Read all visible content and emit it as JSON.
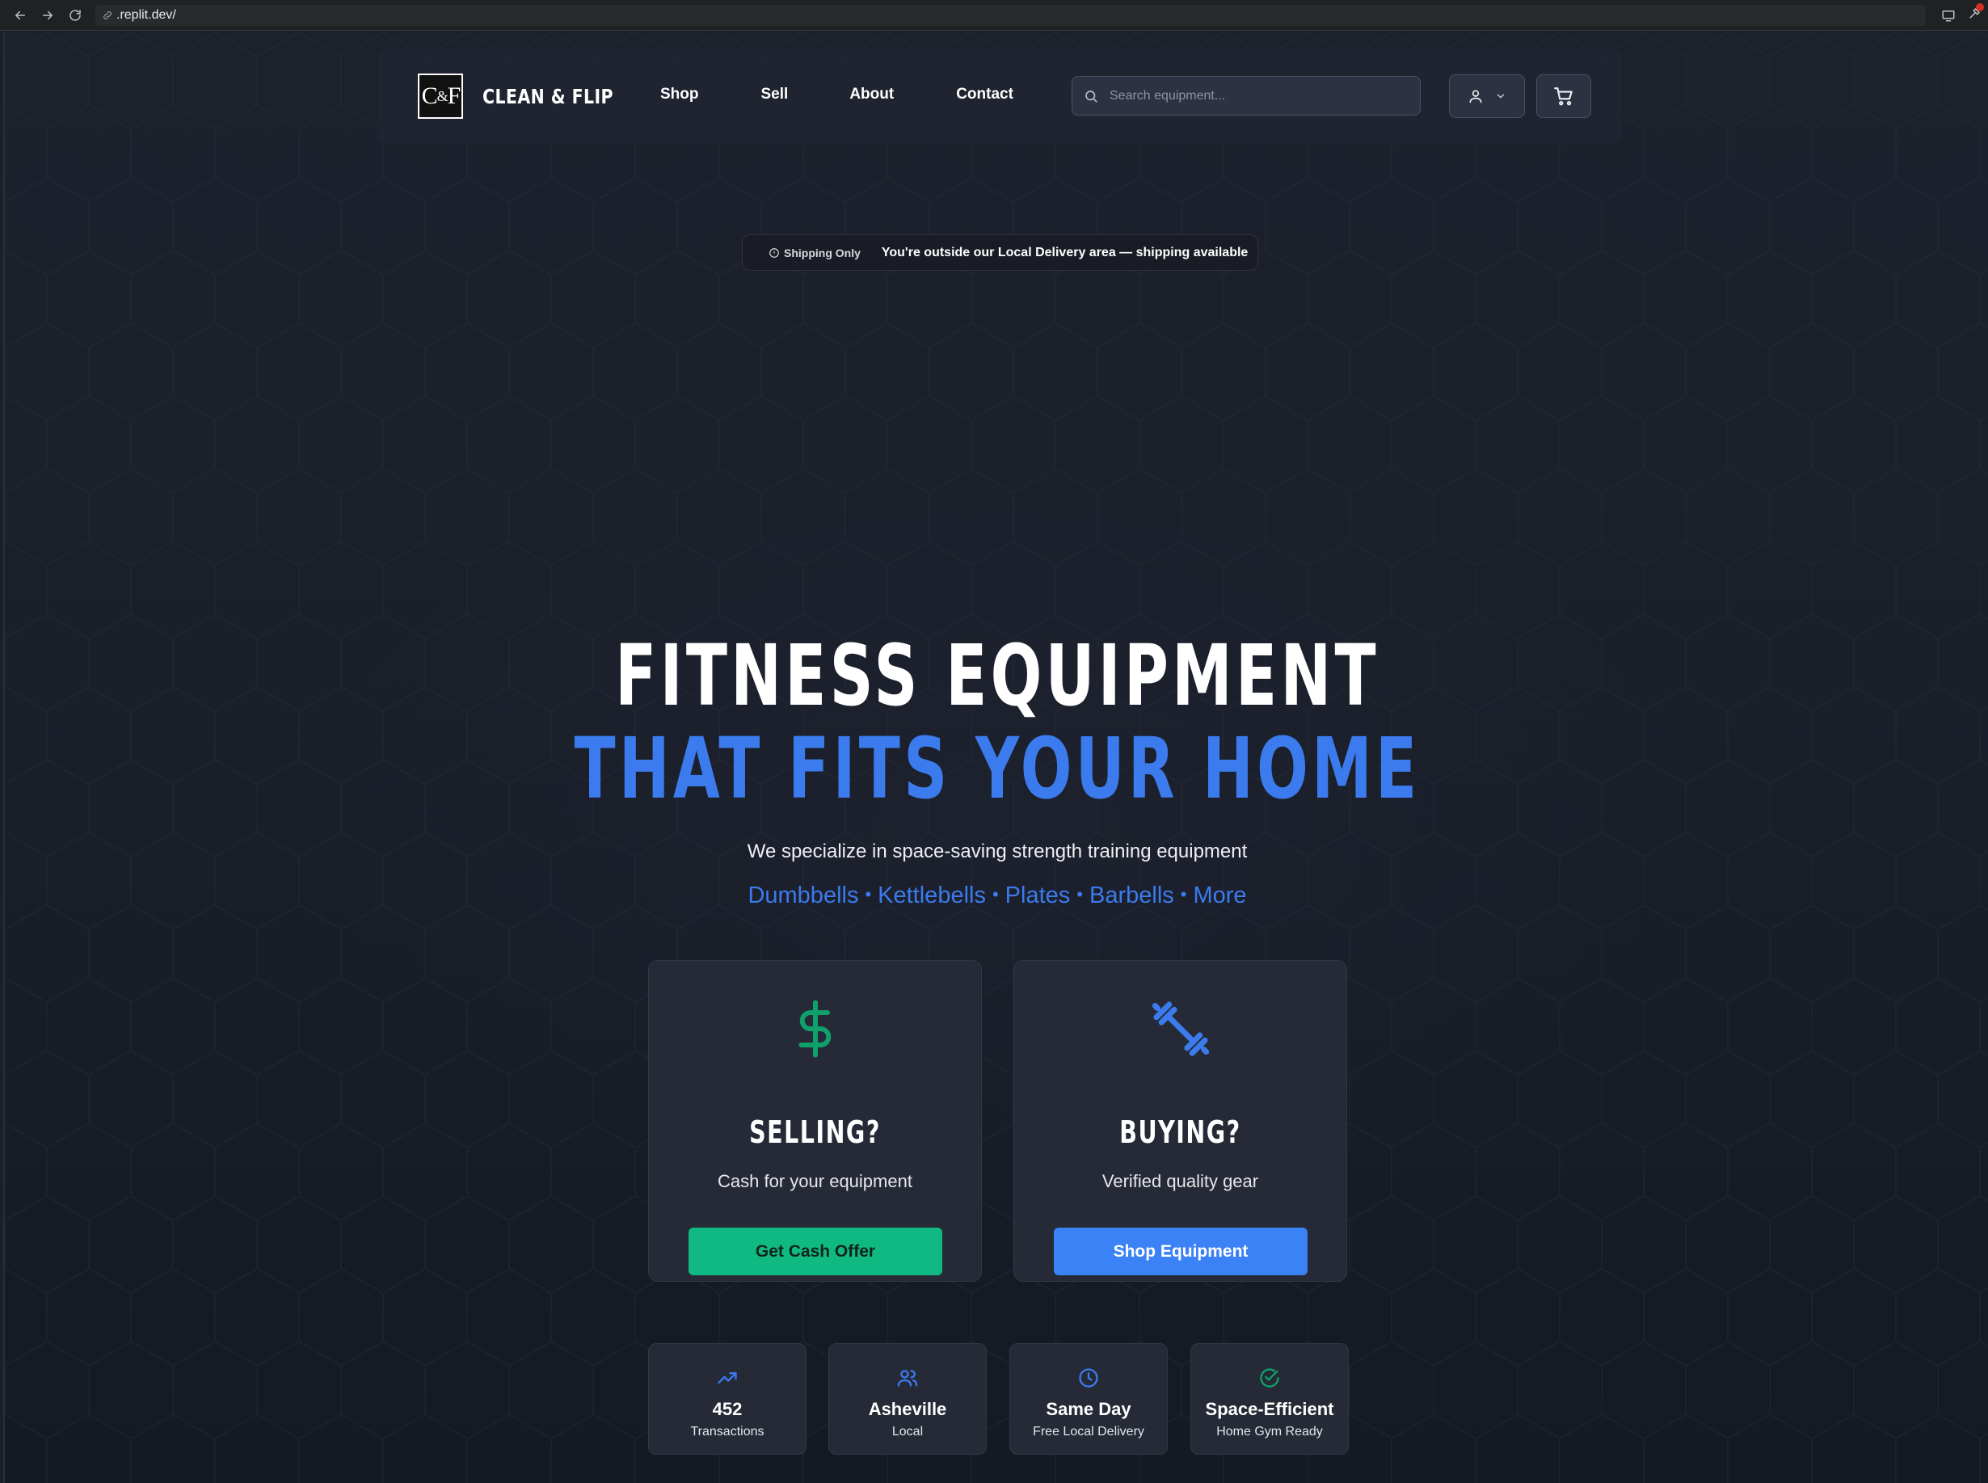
{
  "browser": {
    "url": ".replit.dev/"
  },
  "header": {
    "logo_mark_left": "C",
    "logo_mark_amp": "&",
    "logo_mark_right": "F",
    "brand": "CLEAN & FLIP",
    "nav": [
      "Shop",
      "Sell",
      "About",
      "Contact"
    ],
    "search_placeholder": "Search equipment..."
  },
  "shipping_banner": {
    "tag": "Shipping Only",
    "message": "You're outside our Local Delivery area — shipping available"
  },
  "hero": {
    "line1": "FITNESS EQUIPMENT",
    "line2": "THAT FITS YOUR HOME",
    "subtitle": "We specialize in space-saving strength training equipment",
    "categories": [
      "Dumbbells",
      "Kettlebells",
      "Plates",
      "Barbells",
      "More"
    ]
  },
  "cards": {
    "sell": {
      "icon": "dollar-icon",
      "title": "SELLING?",
      "subtitle": "Cash for your equipment",
      "button": "Get Cash Offer"
    },
    "buy": {
      "icon": "dumbbell-icon",
      "title": "BUYING?",
      "subtitle": "Verified quality gear",
      "button": "Shop Equipment"
    }
  },
  "stats": [
    {
      "icon": "trending-up-icon",
      "value": "452",
      "label": "Transactions"
    },
    {
      "icon": "users-icon",
      "value": "Asheville",
      "label": "Local"
    },
    {
      "icon": "clock-icon",
      "value": "Same Day",
      "label": "Free Local Delivery"
    },
    {
      "icon": "check-circle-icon",
      "value": "Space-Efficient",
      "label": "Home Gym Ready"
    }
  ],
  "colors": {
    "accent_blue": "#3b7bee",
    "accent_green": "#10b981",
    "background": "#1b1f2a",
    "card": "#252a36"
  }
}
